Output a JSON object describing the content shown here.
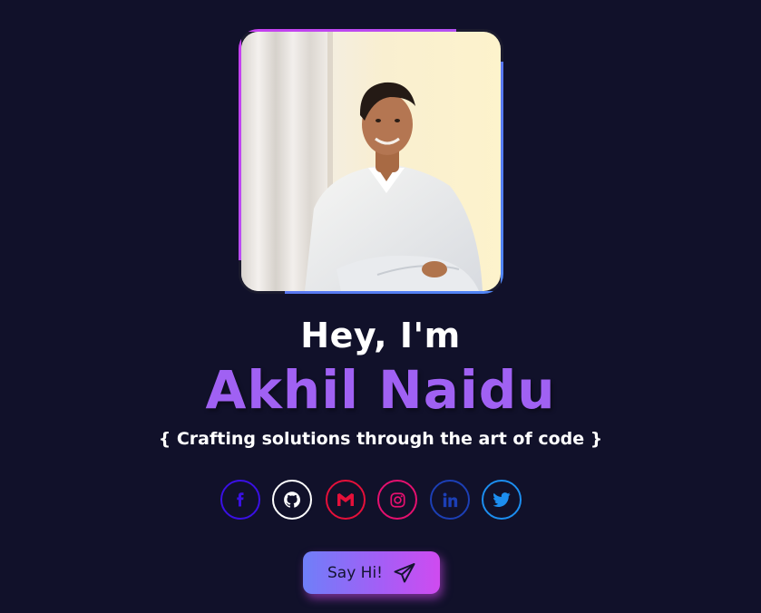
{
  "hero": {
    "greeting": "Hey, I'm",
    "name": "Akhil Naidu",
    "tagline": "{ Crafting solutions through the art of code }"
  },
  "socials": [
    {
      "name": "facebook",
      "icon": "facebook-icon",
      "color": "#3a10e5"
    },
    {
      "name": "github",
      "icon": "github-icon",
      "color": "#ffffff"
    },
    {
      "name": "gmail",
      "icon": "gmail-icon",
      "color": "#e5103a"
    },
    {
      "name": "instagram",
      "icon": "instagram-icon",
      "color": "#e5106f"
    },
    {
      "name": "linkedin",
      "icon": "linkedin-icon",
      "color": "#1c3fb5"
    },
    {
      "name": "twitter",
      "icon": "twitter-icon",
      "color": "#1c8ef0"
    }
  ],
  "cta": {
    "label": "Say Hi!",
    "icon": "paper-plane-icon"
  },
  "colors": {
    "background": "#11112a",
    "accent_purple": "#a061f3",
    "frame_pink": "#c63ff0",
    "frame_blue": "#5a78f0"
  }
}
